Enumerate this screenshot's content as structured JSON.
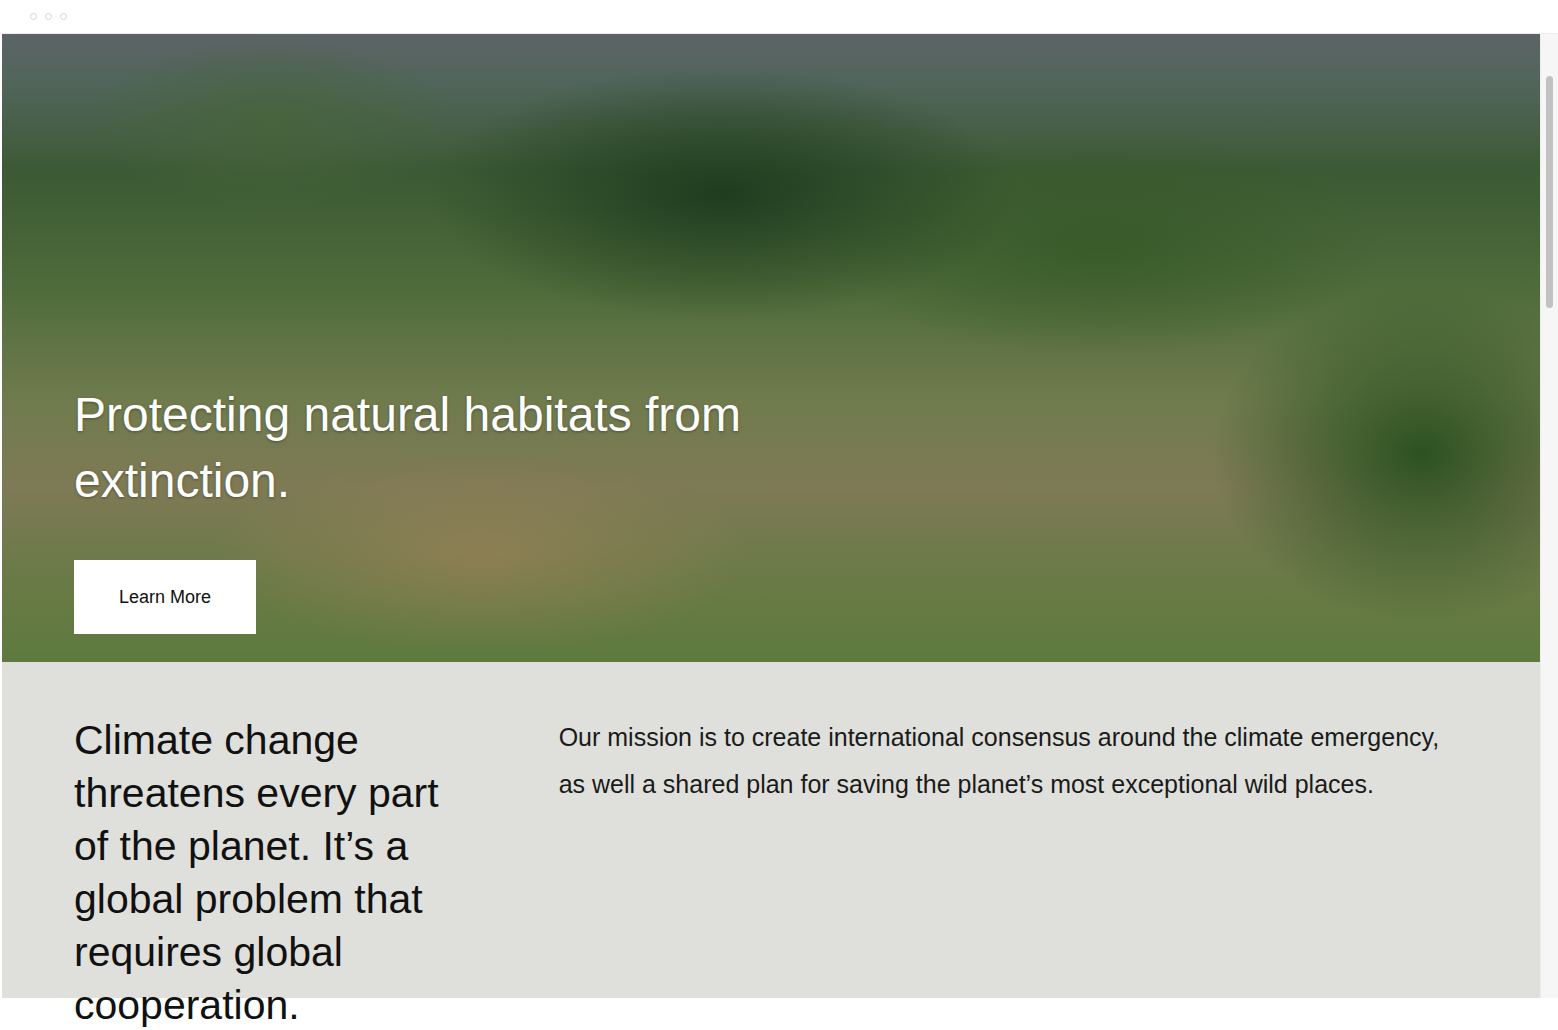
{
  "hero": {
    "title": "Protecting natural habitats from extinction.",
    "button": "Learn More"
  },
  "intro": {
    "heading": "Climate change threatens every part of the planet. It’s a global problem that requires global cooperation.",
    "text": "Our mission is to create international consensus around the climate emergency, as well a shared plan for saving the planet’s most exceptional wild places."
  }
}
